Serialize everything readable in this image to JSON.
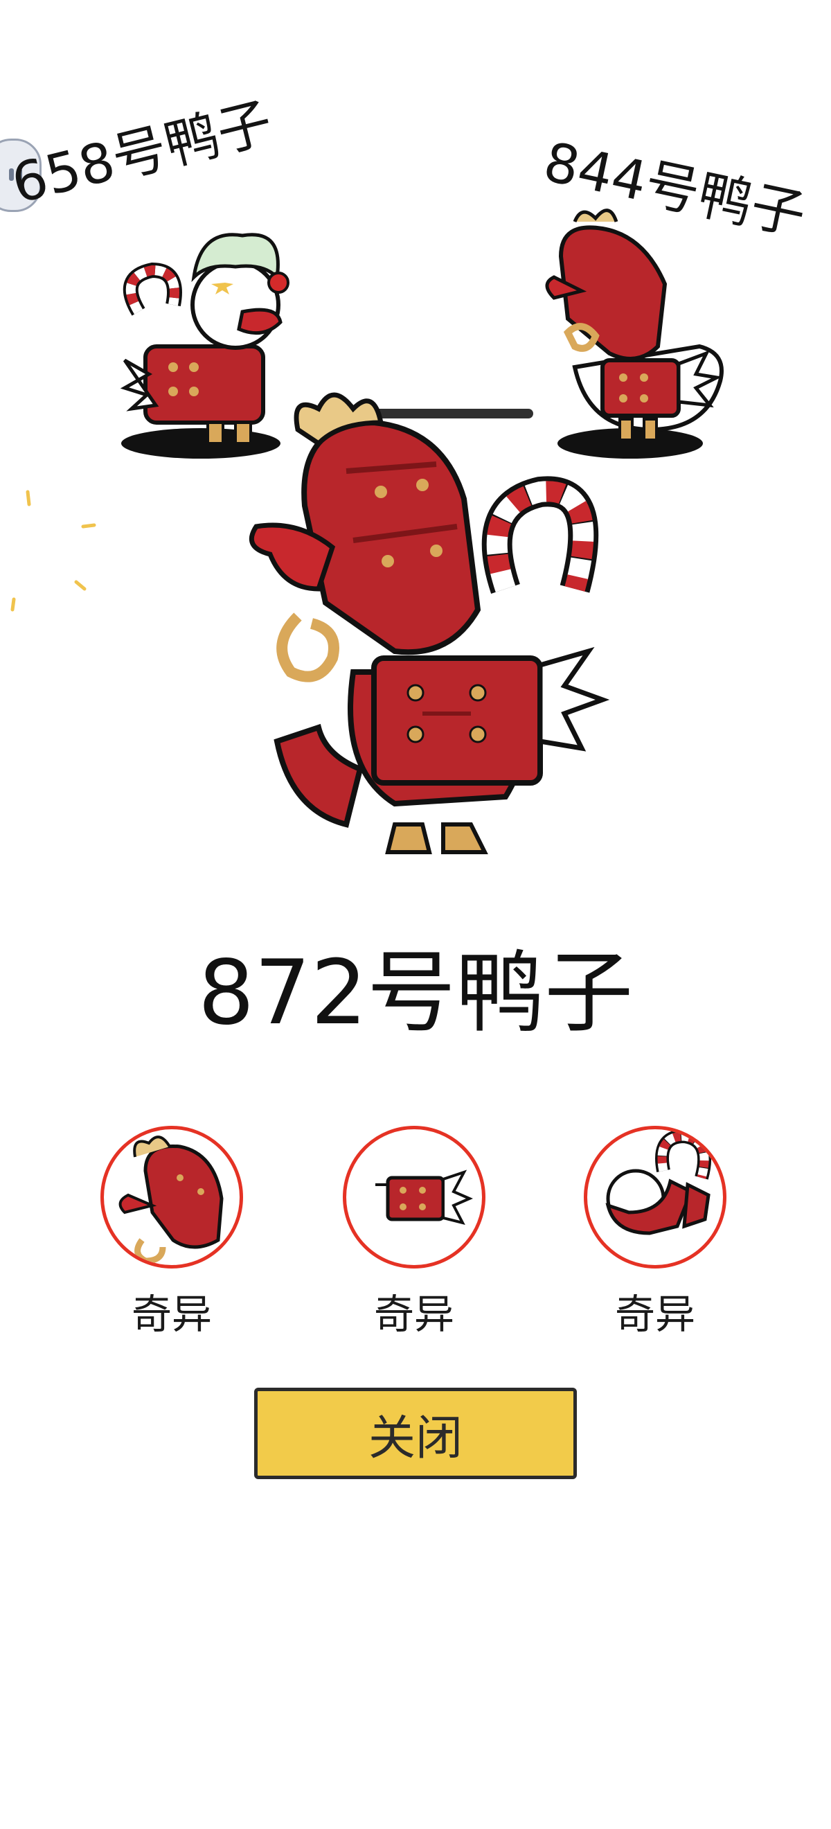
{
  "top_left_duck": {
    "label": "658号鸭子"
  },
  "top_right_duck": {
    "label": "844号鸭子"
  },
  "main_duck": {
    "label": "872号鸭子"
  },
  "parts": [
    {
      "label": "奇异",
      "icon": "dragon-helmet-icon"
    },
    {
      "label": "奇异",
      "icon": "dragon-armor-icon"
    },
    {
      "label": "奇异",
      "icon": "dragon-tail-icon"
    }
  ],
  "close_button": {
    "label": "关闭"
  },
  "colors": {
    "armor_red": "#b8262b",
    "armor_dark": "#7d1518",
    "gold": "#d9a85a",
    "rarity_ring": "#e53224",
    "button_yellow": "#f2cb4a"
  }
}
